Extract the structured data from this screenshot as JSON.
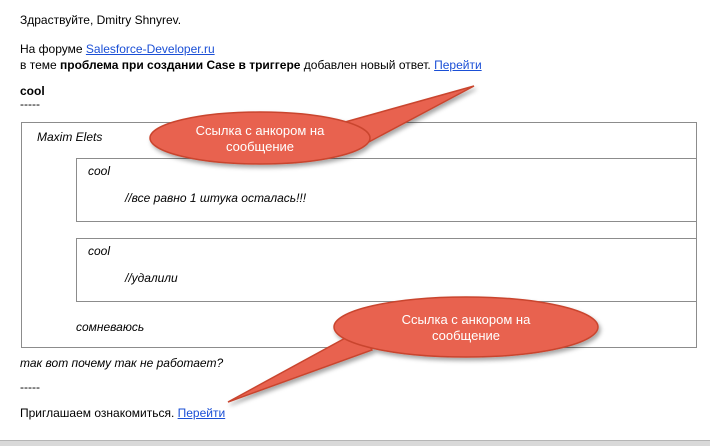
{
  "email": {
    "greeting": "Здраствуйте, Dmitry Shnyrev.",
    "forum_prefix": "На форуме ",
    "forum_link": "Salesforce-Developer.ru",
    "topic_prefix": "в теме ",
    "topic_title": "проблема при создании Case в триггере",
    "topic_suffix": " добавлен новый ответ. ",
    "topic_link": "Перейти",
    "post_title": "cool",
    "separator_1": "-----",
    "outer_quote": {
      "author": "Maxim Elets",
      "inner_quote_1": {
        "title": "cool",
        "text": "//все равно 1 штука осталась!!!"
      },
      "inner_quote_2": {
        "title": "cool",
        "text": "//удалили"
      },
      "reply_text": "сомневаюсь"
    },
    "after_quote_text": "так вот почему так не работает?",
    "separator_2": "-----",
    "invite_text": "Приглашаем ознакомиться. ",
    "invite_link": "Перейти"
  },
  "callouts": {
    "top": {
      "line1": "Ссылка с анкором на",
      "line2": "сообщение"
    },
    "bottom": {
      "line1": "Ссылка с анкором на",
      "line2": "сообщение"
    },
    "fill_color": "#e8624f",
    "stroke_color": "#c9452f"
  }
}
